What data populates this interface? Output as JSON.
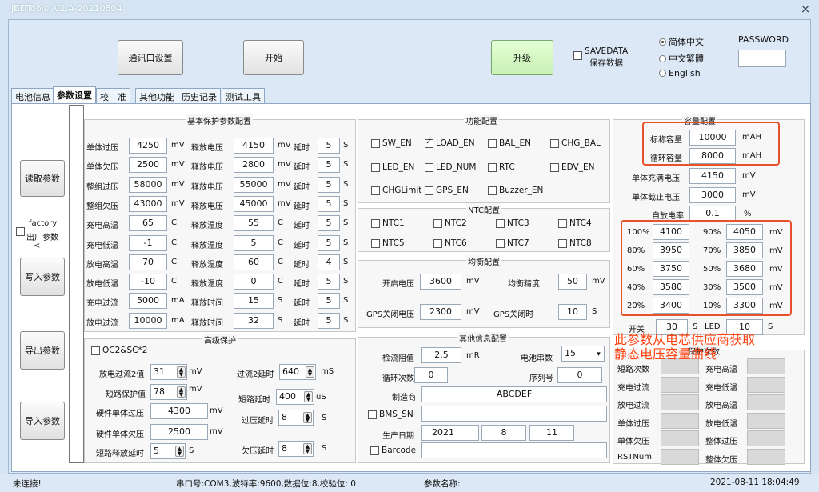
{
  "window": {
    "title": "JBDTools -V2.A-20210804",
    "close": "×"
  },
  "toolbar": {
    "comm_setup": "通讯口设置",
    "start": "开始",
    "upgrade": "升级",
    "savedata_line1": "SAVEDATA",
    "savedata_line2": "保存数据",
    "lang_options": [
      "简体中文",
      "中文繁體",
      "English"
    ],
    "password_label": "PASSWORD",
    "password_value": ""
  },
  "tabs": [
    "电池信息",
    "参数设置",
    "校　准",
    "其他功能",
    "历史记录",
    "测试工具"
  ],
  "left_buttons": {
    "read": "读取参数",
    "factory_line1": "factory",
    "factory_line2": "出厂参数",
    "factory_arrow": "<",
    "write": "写入参数",
    "export": "导出参数",
    "import": "导入参数"
  },
  "basic": {
    "title": "基本保护参数配置",
    "rows": [
      {
        "label": "单体过压",
        "value": "4250",
        "unit": "mV",
        "rlabel": "释放电压",
        "rvalue": "4150",
        "runit": "mV",
        "dlabel": "延时",
        "dvalue": "5",
        "dunit": "S"
      },
      {
        "label": "单体欠压",
        "value": "2500",
        "unit": "mV",
        "rlabel": "释放电压",
        "rvalue": "2800",
        "runit": "mV",
        "dlabel": "延时",
        "dvalue": "5",
        "dunit": "S"
      },
      {
        "label": "整组过压",
        "value": "58000",
        "unit": "mV",
        "rlabel": "释放电压",
        "rvalue": "55000",
        "runit": "mV",
        "dlabel": "延时",
        "dvalue": "5",
        "dunit": "S"
      },
      {
        "label": "整组欠压",
        "value": "43000",
        "unit": "mV",
        "rlabel": "释放电压",
        "rvalue": "45000",
        "runit": "mV",
        "dlabel": "延时",
        "dvalue": "5",
        "dunit": "S"
      },
      {
        "label": "充电高温",
        "value": "65",
        "unit": "C",
        "rlabel": "释放温度",
        "rvalue": "55",
        "runit": "C",
        "dlabel": "延时",
        "dvalue": "5",
        "dunit": "S"
      },
      {
        "label": "充电低温",
        "value": "-1",
        "unit": "C",
        "rlabel": "释放温度",
        "rvalue": "5",
        "runit": "C",
        "dlabel": "延时",
        "dvalue": "5",
        "dunit": "S"
      },
      {
        "label": "放电高温",
        "value": "70",
        "unit": "C",
        "rlabel": "释放温度",
        "rvalue": "60",
        "runit": "C",
        "dlabel": "延时",
        "dvalue": "4",
        "dunit": "S"
      },
      {
        "label": "放电低温",
        "value": "-10",
        "unit": "C",
        "rlabel": "释放温度",
        "rvalue": "0",
        "runit": "C",
        "dlabel": "延时",
        "dvalue": "5",
        "dunit": "S"
      },
      {
        "label": "充电过流",
        "value": "5000",
        "unit": "mA",
        "rlabel": "释放时间",
        "rvalue": "15",
        "runit": "S",
        "dlabel": "延时",
        "dvalue": "5",
        "dunit": "S"
      },
      {
        "label": "放电过流",
        "value": "10000",
        "unit": "mA",
        "rlabel": "释放时间",
        "rvalue": "32",
        "runit": "S",
        "dlabel": "延时",
        "dvalue": "5",
        "dunit": "S"
      }
    ]
  },
  "advanced": {
    "title": "高级保护",
    "oc2sc": "OC2&SC*2",
    "dis_oc2_label": "放电过流2值",
    "dis_oc2_value": "31",
    "dis_oc2_unit": "mV",
    "oc2_delay_label": "过流2延时",
    "oc2_delay_value": "640",
    "oc2_delay_unit": "mS",
    "short_label": "短路保护值",
    "short_value": "78",
    "short_unit": "mV",
    "short_delay_label": "短路延时",
    "short_delay_value": "400",
    "short_delay_unit": "uS",
    "hw_ov_label": "硬件单体过压",
    "hw_ov_value": "4300",
    "hw_ov_unit": "mV",
    "ov_delay_label": "过压延时",
    "ov_delay_value": "8",
    "ov_delay_unit": "S",
    "hw_uv_label": "硬件单体欠压",
    "hw_uv_value": "2500",
    "hw_uv_unit": "mV",
    "short_release_label": "短路释放延时",
    "short_release_value": "5",
    "short_release_unit": "S",
    "uv_delay_label": "欠压延时",
    "uv_delay_value": "8",
    "uv_delay_unit": "S"
  },
  "function": {
    "title": "功能配置",
    "items": [
      {
        "label": "SW_EN",
        "checked": false
      },
      {
        "label": "LOAD_EN",
        "checked": true
      },
      {
        "label": "BAL_EN",
        "checked": false
      },
      {
        "label": "CHG_BAL",
        "checked": false
      },
      {
        "label": "LED_EN",
        "checked": false
      },
      {
        "label": "LED_NUM",
        "checked": false
      },
      {
        "label": "RTC",
        "checked": false
      },
      {
        "label": "EDV_EN",
        "checked": false
      },
      {
        "label": "CHGLimit",
        "checked": false
      },
      {
        "label": "GPS_EN",
        "checked": false
      },
      {
        "label": "Buzzer_EN",
        "checked": false
      }
    ]
  },
  "ntc": {
    "title": "NTC配置",
    "items": [
      "NTC1",
      "NTC2",
      "NTC3",
      "NTC4",
      "NTC5",
      "NTC6",
      "NTC7",
      "NTC8"
    ]
  },
  "balance": {
    "title": "均衡配置",
    "start_v_label": "开启电压",
    "start_v_value": "3600",
    "start_v_unit": "mV",
    "precision_label": "均衡精度",
    "precision_value": "50",
    "precision_unit": "mV",
    "gps_off_v_label": "GPS关闭电压",
    "gps_off_v_value": "2300",
    "gps_off_v_unit": "mV",
    "gps_off_t_label": "GPS关闭时",
    "gps_off_t_value": "10",
    "gps_off_t_unit": "S"
  },
  "other": {
    "title": "其他信息配置",
    "shunt_label": "检流阻值",
    "shunt_value": "2.5",
    "shunt_unit": "mR",
    "cells_label": "电池串数",
    "cells_value": "15",
    "cycles_label": "循环次数",
    "cycles_value": "0",
    "serial_label": "序列号",
    "serial_value": "0",
    "maker_label": "制造商",
    "maker_value": "ABCDEF",
    "bms_sn_label": "BMS_SN",
    "bms_sn_value": "",
    "date_label": "生产日期",
    "year": "2021",
    "month": "8",
    "day": "11",
    "barcode_label": "Barcode",
    "barcode_value": ""
  },
  "capacity": {
    "title": "容量配置",
    "nominal_label": "标称容量",
    "nominal_value": "10000",
    "nominal_unit": "mAH",
    "cycle_label": "循环容量",
    "cycle_value": "8000",
    "cycle_unit": "mAH",
    "full_v_label": "单体充满电压",
    "full_v_value": "4150",
    "full_v_unit": "mV",
    "cutoff_v_label": "单体截止电压",
    "cutoff_v_value": "3000",
    "cutoff_v_unit": "mV",
    "self_dis_label": "自放电率",
    "self_dis_value": "0.1",
    "self_dis_unit": "%",
    "soc": [
      {
        "label": "100%",
        "value": "4100",
        "label2": "90%",
        "value2": "4050",
        "unit": "mV"
      },
      {
        "label": "80%",
        "value": "3950",
        "label2": "70%",
        "value2": "3850",
        "unit": "mV"
      },
      {
        "label": "60%",
        "value": "3750",
        "label2": "50%",
        "value2": "3680",
        "unit": "mV"
      },
      {
        "label": "40%",
        "value": "3580",
        "label2": "30%",
        "value2": "3500",
        "unit": "mV"
      },
      {
        "label": "20%",
        "value": "3400",
        "label2": "10%",
        "value2": "3300",
        "unit": "mV"
      }
    ],
    "switch_label": "开关",
    "switch_value": "30",
    "switch_unit": "S",
    "led_label": "LED",
    "led_value": "10",
    "led_unit": "S"
  },
  "annotation": {
    "line1": "此参数从电芯供应商获取",
    "line2": "静态电压容量曲线"
  },
  "protect_count": {
    "title": "保护次数",
    "left": [
      "短路次数",
      "充电过流",
      "放电过流",
      "单体过压",
      "单体欠压",
      "RSTNum"
    ],
    "right": [
      "充电高温",
      "充电低温",
      "放电高温",
      "放电低温",
      "整体过压",
      "整体欠压"
    ]
  },
  "status": {
    "conn": "未连接!",
    "serial": "串口号:COM3,波特率:9600,数据位:8,校验位: 0",
    "param": "参数名称:",
    "datetime": "2021-08-11 18:04:49"
  }
}
